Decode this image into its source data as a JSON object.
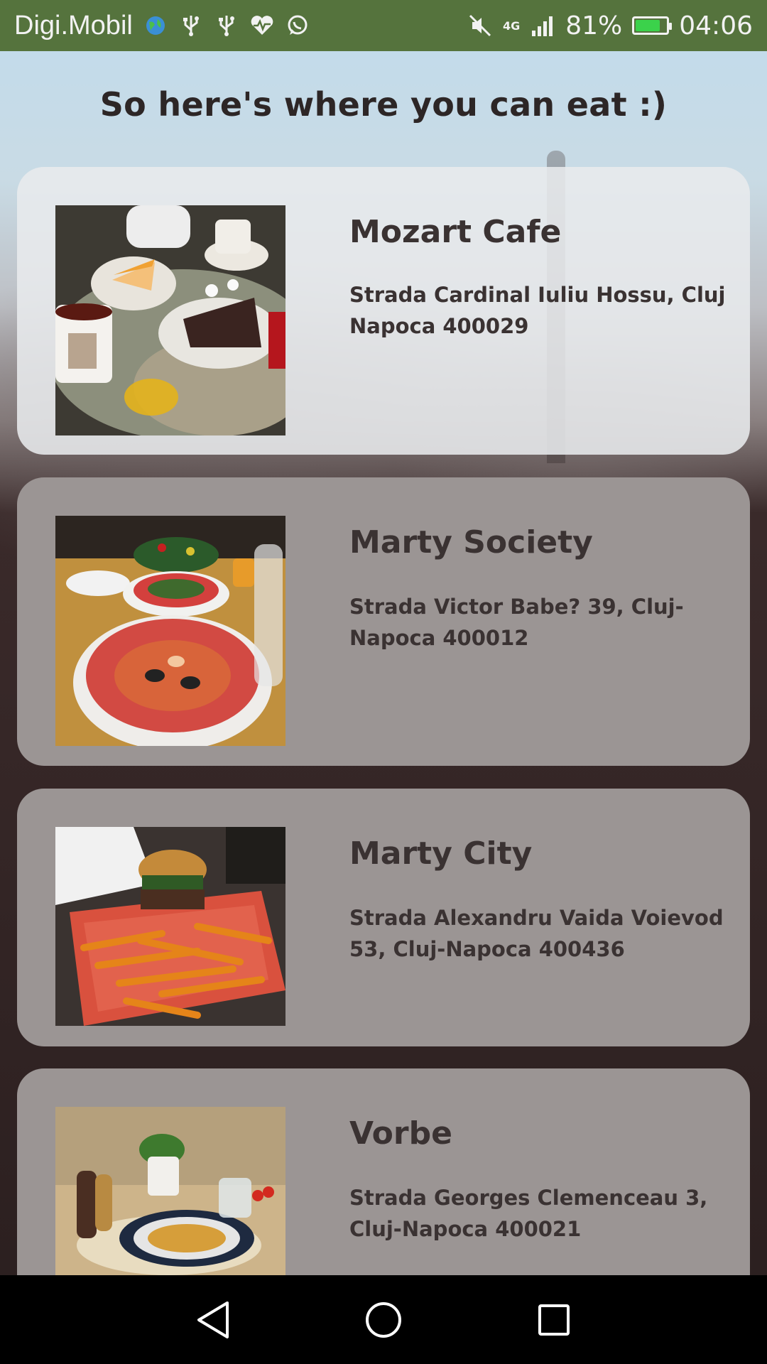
{
  "status_bar": {
    "carrier": "Digi.Mobil",
    "network": "4G",
    "battery": "81%",
    "battery_level": 0.81,
    "time": "04:06",
    "icons": [
      "globe-icon",
      "usb-icon",
      "usb-icon",
      "health-icon",
      "whatsapp-icon",
      "mute-icon",
      "signal-icon",
      "battery-icon"
    ]
  },
  "page": {
    "title": "So here's where you can eat :)"
  },
  "restaurants": [
    {
      "name": "Mozart Cafe",
      "address": "Strada Cardinal Iuliu Hossu, Cluj Napoca 400029",
      "photo": "cake-and-tea-photo"
    },
    {
      "name": "Marty Society",
      "address": "Strada Victor Babe? 39, Cluj-Napoca 400012",
      "photo": "seafood-soup-photo"
    },
    {
      "name": "Marty City",
      "address": "Strada Alexandru Vaida Voievod 53, Cluj-Napoca 400436",
      "photo": "burger-and-fries-photo"
    },
    {
      "name": "Vorbe",
      "address": "Strada Georges Clemenceau 3, Cluj-Napoca 400021",
      "photo": "fish-and-potatoes-photo"
    }
  ],
  "nav": {
    "back": "back-icon",
    "home": "home-icon",
    "recents": "recents-icon"
  },
  "colors": {
    "status_bar": "#55733d",
    "card_first": "#e8eaed",
    "card": "#9b9594",
    "text": "#3a3232"
  }
}
